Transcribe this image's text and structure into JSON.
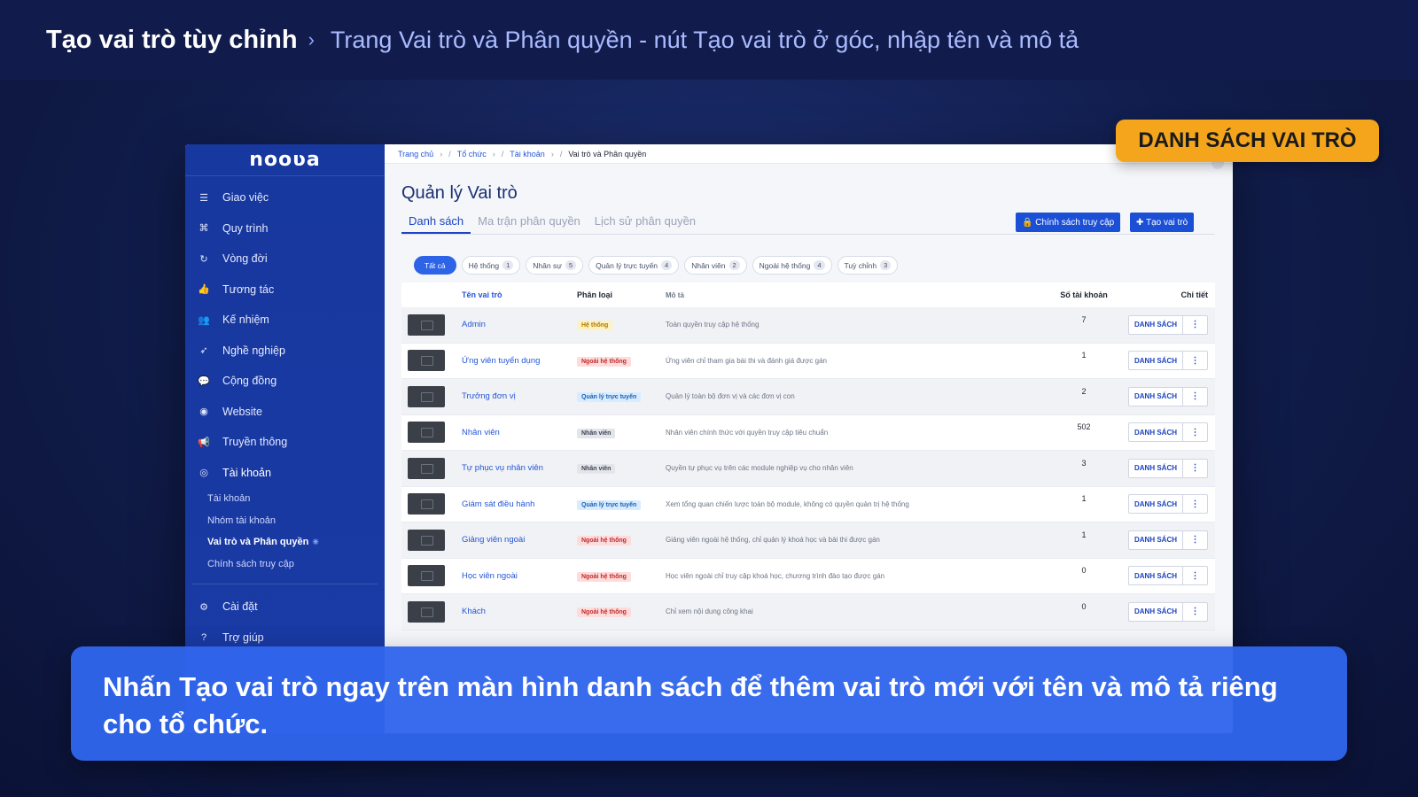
{
  "header": {
    "title": "Tạo vai trò tùy chỉnh",
    "chevron": "›",
    "subtitle": "Trang Vai trò và Phân quyền - nút Tạo vai trò ở góc, nhập tên và mô tả"
  },
  "tag_label": "DANH SÁCH VAI TRÒ",
  "caption": "Nhấn Tạo vai trò ngay trên màn hình danh sách để thêm vai trò mới với tên và mô tả riêng cho tổ chức.",
  "app": {
    "logo": "nooʋa",
    "sidebar": {
      "items": [
        {
          "icon": "tasks-icon",
          "glyph": "☰",
          "label": "Giao việc"
        },
        {
          "icon": "workflow-icon",
          "glyph": "⌘",
          "label": "Quy trình"
        },
        {
          "icon": "cycle-icon",
          "glyph": "↻",
          "label": "Vòng đời"
        },
        {
          "icon": "thumbs-up-icon",
          "glyph": "👍",
          "label": "Tương tác"
        },
        {
          "icon": "users-icon",
          "glyph": "👥",
          "label": "Kế nhiệm"
        },
        {
          "icon": "rocket-icon",
          "glyph": "➶",
          "label": "Nghề nghiệp"
        },
        {
          "icon": "chat-icon",
          "glyph": "💬",
          "label": "Cộng đồng"
        },
        {
          "icon": "globe-icon",
          "glyph": "◉",
          "label": "Website"
        },
        {
          "icon": "megaphone-icon",
          "glyph": "📢",
          "label": "Truyền thông"
        },
        {
          "icon": "user-circle-icon",
          "glyph": "◎",
          "label": "Tài khoản"
        }
      ],
      "sub_items": [
        {
          "label": "Tài khoản"
        },
        {
          "label": "Nhóm tài khoản"
        },
        {
          "label": "Vai trò và Phân quyền"
        },
        {
          "label": "Chính sách truy cập"
        }
      ],
      "bottom_items": [
        {
          "icon": "gear-icon",
          "glyph": "⚙",
          "label": "Cài đặt"
        },
        {
          "icon": "help-icon",
          "glyph": "?",
          "label": "Trợ giúp"
        }
      ],
      "active_marker": "✳"
    },
    "breadcrumb": [
      "Trang chủ",
      "Tổ chức",
      "Tài khoản",
      "Vai trò và Phân quyền"
    ],
    "page_title": "Quản lý Vai trò",
    "tabs": [
      "Danh sách",
      "Ma trận phân quyền",
      "Lịch sử phân quyền"
    ],
    "buttons": {
      "policy": "🔒 Chính sách truy cập",
      "create": "✚ Tạo vai trò"
    },
    "filters": [
      {
        "label": "Tất cả",
        "count": ""
      },
      {
        "label": "Hệ thống",
        "count": "1"
      },
      {
        "label": "Nhân sự",
        "count": "5"
      },
      {
        "label": "Quản lý trực tuyến",
        "count": "4"
      },
      {
        "label": "Nhân viên",
        "count": "2"
      },
      {
        "label": "Ngoài hệ thống",
        "count": "4"
      },
      {
        "label": "Tuỳ chỉnh",
        "count": "3"
      }
    ],
    "table": {
      "columns": [
        "",
        "Tên vai trò",
        "Phân loại",
        "Mô tả",
        "Số tài khoản",
        "Chi tiết"
      ],
      "action_label": "DANH SÁCH",
      "more_label": "⋮",
      "rows": [
        {
          "name": "Admin",
          "category": "Hệ thống",
          "kind": "system",
          "desc": "Toàn quyền truy cập hệ thống",
          "count": "7"
        },
        {
          "name": "Ứng viên tuyển dụng",
          "category": "Ngoài hệ thống",
          "kind": "external",
          "desc": "Ứng viên chỉ tham gia bài thi và đánh giá được gán",
          "count": "1"
        },
        {
          "name": "Trưởng đơn vị",
          "category": "Quản lý trực tuyến",
          "kind": "online",
          "desc": "Quản lý toàn bộ đơn vị và các đơn vị con",
          "count": "2"
        },
        {
          "name": "Nhân viên",
          "category": "Nhân viên",
          "kind": "staff",
          "desc": "Nhân viên chính thức với quyền truy cập tiêu chuẩn",
          "count": "502"
        },
        {
          "name": "Tự phục vụ nhân viên",
          "category": "Nhân viên",
          "kind": "staff",
          "desc": "Quyền tự phục vụ trên các module nghiệp vụ cho nhân viên",
          "count": "3"
        },
        {
          "name": "Giám sát điều hành",
          "category": "Quản lý trực tuyến",
          "kind": "online",
          "desc": "Xem tổng quan chiến lược toàn bộ module, không có quyền quản trị hệ thống",
          "count": "1"
        },
        {
          "name": "Giảng viên ngoài",
          "category": "Ngoài hệ thống",
          "kind": "external",
          "desc": "Giảng viên ngoài hệ thống, chỉ quản lý khoá học và bài thi được gán",
          "count": "1"
        },
        {
          "name": "Học viên ngoài",
          "category": "Ngoài hệ thống",
          "kind": "external",
          "desc": "Học viên ngoài chỉ truy cập khoá học, chương trình đào tạo được gán",
          "count": "0"
        },
        {
          "name": "Khách",
          "category": "Ngoài hệ thống",
          "kind": "external",
          "desc": "Chỉ xem nội dung công khai",
          "count": "0"
        }
      ]
    }
  }
}
